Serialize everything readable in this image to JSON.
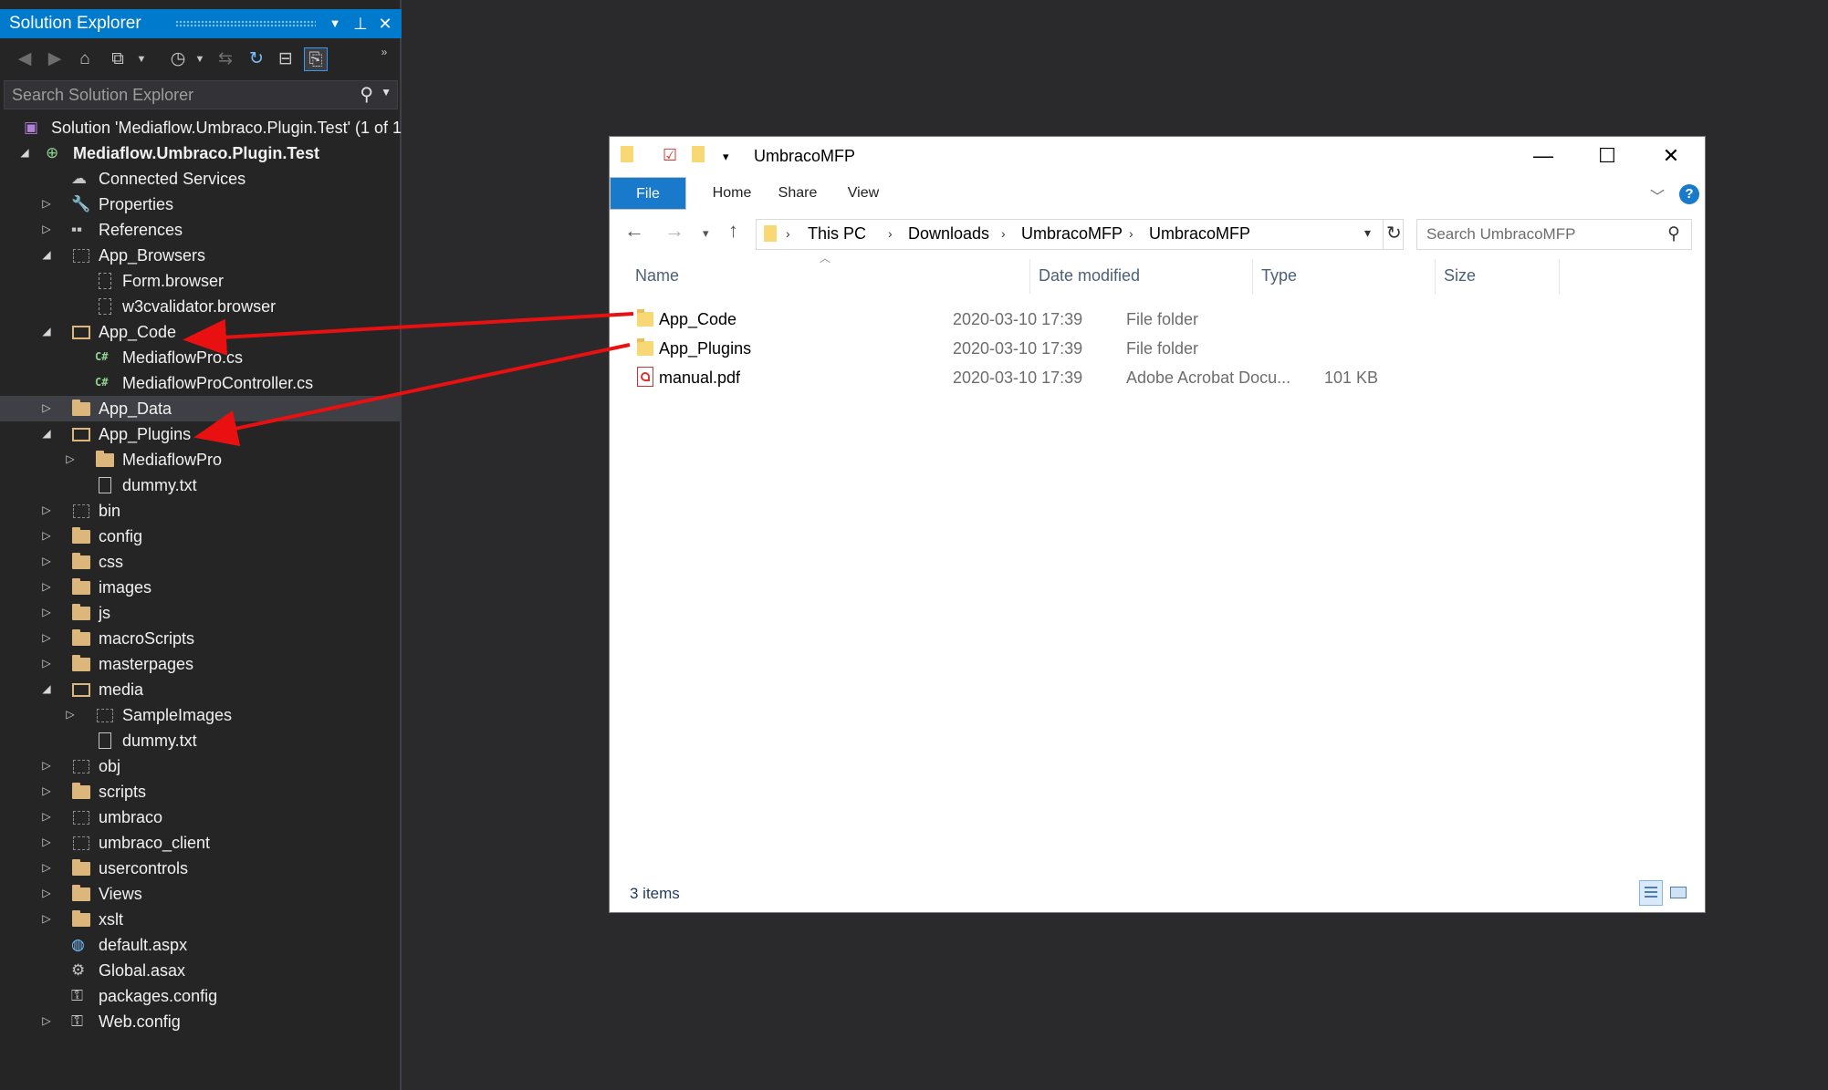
{
  "solution_explorer": {
    "title": "Solution Explorer",
    "search_placeholder": "Search Solution Explorer",
    "tree": [
      {
        "label": "Solution 'Mediaflow.Umbraco.Plugin.Test' (1 of 1",
        "icon": "solution-icon",
        "indent": 0,
        "arrow": ""
      },
      {
        "label": "Mediaflow.Umbraco.Plugin.Test",
        "icon": "web-project-icon",
        "indent": 1,
        "arrow": "down",
        "bold": true
      },
      {
        "label": "Connected Services",
        "icon": "connected-services-icon",
        "indent": 2,
        "arrow": ""
      },
      {
        "label": "Properties",
        "icon": "wrench-icon",
        "indent": 2,
        "arrow": "right"
      },
      {
        "label": "References",
        "icon": "references-icon",
        "indent": 2,
        "arrow": "right"
      },
      {
        "label": "App_Browsers",
        "icon": "dashed-folder-open-icon",
        "indent": 2,
        "arrow": "down"
      },
      {
        "label": "Form.browser",
        "icon": "dashed-file-icon",
        "indent": 3,
        "arrow": ""
      },
      {
        "label": "w3cvalidator.browser",
        "icon": "dashed-file-icon",
        "indent": 3,
        "arrow": ""
      },
      {
        "label": "App_Code",
        "icon": "folder-open-icon",
        "indent": 2,
        "arrow": "down"
      },
      {
        "label": "MediaflowPro.cs",
        "icon": "csharp-file-icon",
        "indent": 3,
        "arrow": ""
      },
      {
        "label": "MediaflowProController.cs",
        "icon": "csharp-file-icon",
        "indent": 3,
        "arrow": ""
      },
      {
        "label": "App_Data",
        "icon": "folder-icon",
        "indent": 2,
        "arrow": "right",
        "highlight": true
      },
      {
        "label": "App_Plugins",
        "icon": "folder-open-icon",
        "indent": 2,
        "arrow": "down"
      },
      {
        "label": "MediaflowPro",
        "icon": "folder-icon",
        "indent": 3,
        "arrow": "right"
      },
      {
        "label": "dummy.txt",
        "icon": "text-file-icon",
        "indent": 3,
        "arrow": ""
      },
      {
        "label": "bin",
        "icon": "dashed-folder-icon",
        "indent": 2,
        "arrow": "right"
      },
      {
        "label": "config",
        "icon": "folder-icon",
        "indent": 2,
        "arrow": "right"
      },
      {
        "label": "css",
        "icon": "folder-icon",
        "indent": 2,
        "arrow": "right"
      },
      {
        "label": "images",
        "icon": "folder-icon",
        "indent": 2,
        "arrow": "right"
      },
      {
        "label": "js",
        "icon": "folder-icon",
        "indent": 2,
        "arrow": "right"
      },
      {
        "label": "macroScripts",
        "icon": "folder-icon",
        "indent": 2,
        "arrow": "right"
      },
      {
        "label": "masterpages",
        "icon": "folder-icon",
        "indent": 2,
        "arrow": "right"
      },
      {
        "label": "media",
        "icon": "folder-open-icon",
        "indent": 2,
        "arrow": "down"
      },
      {
        "label": "SampleImages",
        "icon": "dashed-folder-icon",
        "indent": 3,
        "arrow": "right"
      },
      {
        "label": "dummy.txt",
        "icon": "text-file-icon",
        "indent": 3,
        "arrow": ""
      },
      {
        "label": "obj",
        "icon": "dashed-folder-icon",
        "indent": 2,
        "arrow": "right"
      },
      {
        "label": "scripts",
        "icon": "folder-icon",
        "indent": 2,
        "arrow": "right"
      },
      {
        "label": "umbraco",
        "icon": "dashed-folder-icon",
        "indent": 2,
        "arrow": "right"
      },
      {
        "label": "umbraco_client",
        "icon": "dashed-folder-icon",
        "indent": 2,
        "arrow": "right"
      },
      {
        "label": "usercontrols",
        "icon": "folder-icon",
        "indent": 2,
        "arrow": "right"
      },
      {
        "label": "Views",
        "icon": "folder-icon",
        "indent": 2,
        "arrow": "right"
      },
      {
        "label": "xslt",
        "icon": "folder-icon",
        "indent": 2,
        "arrow": "right"
      },
      {
        "label": "default.aspx",
        "icon": "aspx-file-icon",
        "indent": 2,
        "arrow": ""
      },
      {
        "label": "Global.asax",
        "icon": "asax-file-icon",
        "indent": 2,
        "arrow": ""
      },
      {
        "label": "packages.config",
        "icon": "config-file-icon",
        "indent": 2,
        "arrow": ""
      },
      {
        "label": "Web.config",
        "icon": "config-file-icon",
        "indent": 2,
        "arrow": "right"
      }
    ]
  },
  "explorer": {
    "title": "UmbracoMFP",
    "tabs": [
      "File",
      "Home",
      "Share",
      "View"
    ],
    "breadcrumbs": [
      "This PC",
      "Downloads",
      "UmbracoMFP",
      "UmbracoMFP"
    ],
    "search_placeholder": "Search UmbracoMFP",
    "columns": {
      "name": "Name",
      "date": "Date modified",
      "type": "Type",
      "size": "Size"
    },
    "files": [
      {
        "name": "App_Code",
        "date": "2020-03-10 17:39",
        "type": "File folder",
        "size": "",
        "icon": "folder-icon"
      },
      {
        "name": "App_Plugins",
        "date": "2020-03-10 17:39",
        "type": "File folder",
        "size": "",
        "icon": "folder-icon"
      },
      {
        "name": "manual.pdf",
        "date": "2020-03-10 17:39",
        "type": "Adobe Acrobat Docu...",
        "size": "101 KB",
        "icon": "pdf-icon"
      }
    ],
    "status": "3 items"
  },
  "colors": {
    "accent": "#007acc",
    "ribbon_file": "#1979ca",
    "arrow": "#e81010",
    "folder": "#dcb67a"
  }
}
